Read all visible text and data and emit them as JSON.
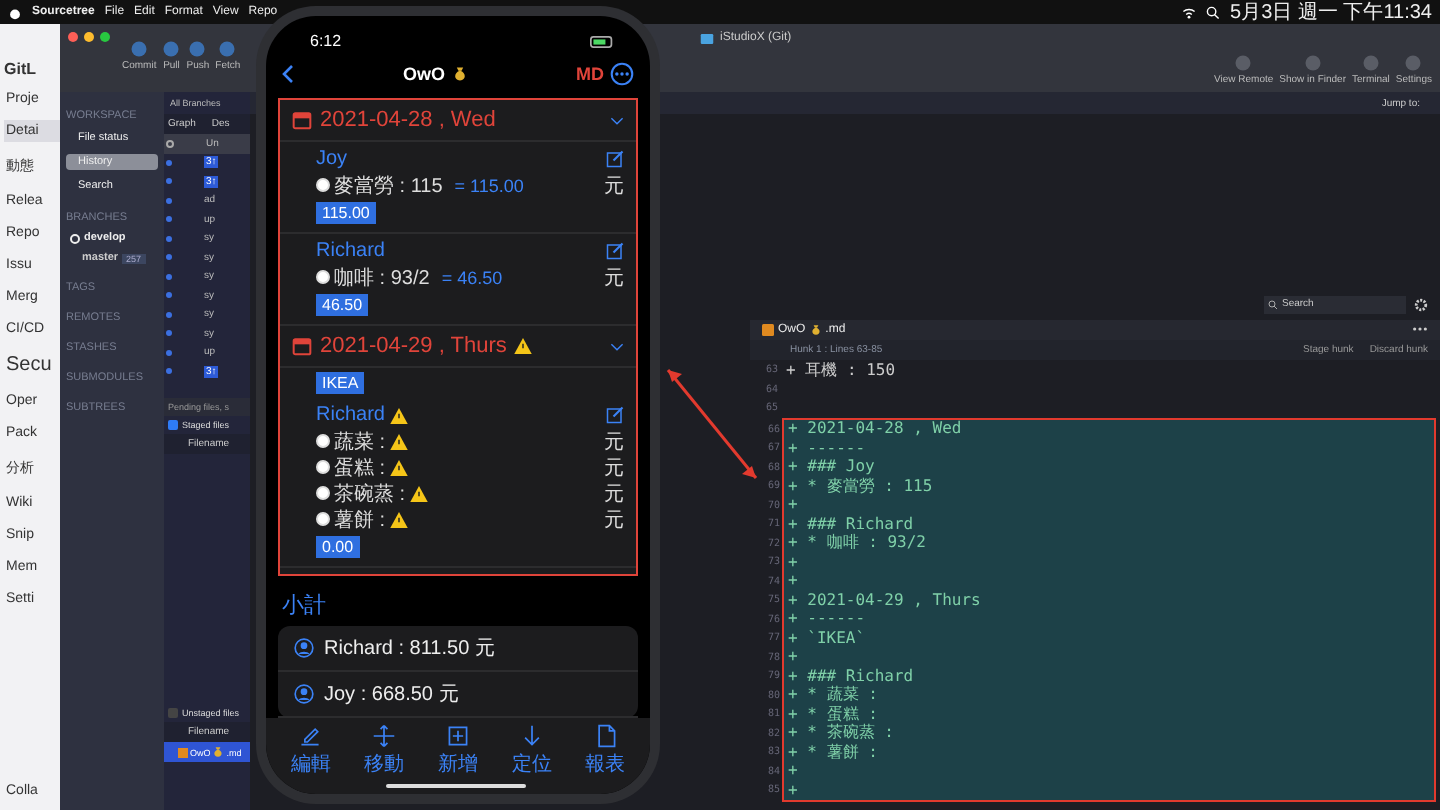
{
  "menu_bar": {
    "app": "Sourcetree",
    "menus": [
      "File",
      "Edit",
      "Format",
      "View",
      "Repo"
    ],
    "clock": "5月3日 週一 下午11:34"
  },
  "browser_sidebar": {
    "brand": "GitL",
    "items": [
      {
        "label": "Proje",
        "selected": false
      },
      {
        "label": "Detai",
        "selected": true
      },
      {
        "label": "動態",
        "selected": false
      },
      {
        "label": "Relea",
        "selected": false
      },
      {
        "label": "Repo",
        "selected": false
      },
      {
        "label": "Issu",
        "selected": false
      },
      {
        "label": "Merg",
        "selected": false
      },
      {
        "label": "CI/CD",
        "selected": false
      },
      {
        "label": "Secu",
        "selected": false
      },
      {
        "label": "Oper",
        "selected": false
      },
      {
        "label": "Pack",
        "selected": false
      },
      {
        "label": "分析",
        "selected": false
      },
      {
        "label": "Wiki",
        "selected": false
      },
      {
        "label": "Snip",
        "selected": false
      },
      {
        "label": "Mem",
        "selected": false
      },
      {
        "label": "Setti",
        "selected": false
      }
    ],
    "collapse": "Colla"
  },
  "window": {
    "title": "iStudioX (Git)",
    "toolbar_left": [
      "Commit",
      "Pull",
      "Push",
      "Fetch"
    ],
    "toolbar_right": [
      "View Remote",
      "Show in Finder",
      "Terminal",
      "Settings"
    ],
    "jump_label": "Jump to:"
  },
  "sidebar": [
    {
      "kind": "section",
      "label": "WORKSPACE"
    },
    {
      "kind": "item",
      "label": "File status",
      "selected": false
    },
    {
      "kind": "item",
      "label": "History",
      "selected": true
    },
    {
      "kind": "item",
      "label": "Search",
      "selected": false
    },
    {
      "kind": "section",
      "label": "BRANCHES"
    },
    {
      "kind": "branch",
      "label": "develop",
      "current": true
    },
    {
      "kind": "branch",
      "label": "master",
      "current": false,
      "badge": "257"
    },
    {
      "kind": "section",
      "label": "TAGS"
    },
    {
      "kind": "section",
      "label": "REMOTES"
    },
    {
      "kind": "section",
      "label": "STASHES"
    },
    {
      "kind": "section",
      "label": "SUBMODULES"
    },
    {
      "kind": "section",
      "label": "SUBTREES"
    }
  ],
  "commit_list": {
    "filter": "All Branches",
    "columns": [
      "Graph",
      "Des"
    ],
    "rows": [
      {
        "text": "Un",
        "kind": "uncommitted"
      },
      {
        "text": "3↑",
        "kind": "tag"
      },
      {
        "text": "3↑",
        "kind": "tag"
      },
      {
        "text": "ad",
        "kind": "plain"
      },
      {
        "text": "up",
        "kind": "plain"
      },
      {
        "text": "sy",
        "kind": "plain"
      },
      {
        "text": "sy",
        "kind": "plain"
      },
      {
        "text": "sy",
        "kind": "plain"
      },
      {
        "text": "sy",
        "kind": "plain"
      },
      {
        "text": "sy",
        "kind": "plain"
      },
      {
        "text": "sy",
        "kind": "plain"
      },
      {
        "text": "up",
        "kind": "plain"
      },
      {
        "text": "3↑",
        "kind": "tag"
      }
    ]
  },
  "pending": {
    "title": "Pending files, s",
    "staged": {
      "label": "Staged files",
      "checked": true
    },
    "staged_column": "Filename",
    "unstaged": {
      "label": "Unstaged files",
      "checked": false
    },
    "unstaged_column": "Filename",
    "files": [
      {
        "name": "OwO",
        "ext": ".md",
        "selected": true
      }
    ]
  },
  "diff": {
    "search": {
      "placeholder": "Search"
    },
    "file": {
      "name": "OwO",
      "ext": ".md"
    },
    "hunk": "Hunk 1 : Lines 63-85",
    "buttons": [
      "Stage hunk",
      "Discard hunk"
    ],
    "lines": [
      {
        "num": "63",
        "text": "+ 耳機 : 150",
        "added": false
      },
      {
        "num": "64",
        "added": false
      },
      {
        "num": "65",
        "added": false
      },
      {
        "num": "66",
        "text": "+ 2021-04-28 , Wed",
        "added": true
      },
      {
        "num": "67",
        "text": "+ ------",
        "added": true
      },
      {
        "num": "68",
        "text": "+ ### Joy",
        "added": true
      },
      {
        "num": "69",
        "text": "+ * 麥當勞 : 115",
        "added": true
      },
      {
        "num": "70",
        "text": "+",
        "added": true
      },
      {
        "num": "71",
        "text": "+ ### Richard",
        "added": true
      },
      {
        "num": "72",
        "text": "+ * 咖啡 : 93/2",
        "added": true
      },
      {
        "num": "73",
        "text": "+",
        "added": true
      },
      {
        "num": "74",
        "text": "+",
        "added": true
      },
      {
        "num": "75",
        "text": "+ 2021-04-29 , Thurs",
        "added": true
      },
      {
        "num": "76",
        "text": "+ ------",
        "added": true
      },
      {
        "num": "77",
        "text": "+ `IKEA`",
        "added": true
      },
      {
        "num": "78",
        "text": "+",
        "added": true
      },
      {
        "num": "79",
        "text": "+ ### Richard",
        "added": true
      },
      {
        "num": "80",
        "text": "+ * 蔬菜 :",
        "added": true
      },
      {
        "num": "81",
        "text": "+ * 蛋糕 :",
        "added": true
      },
      {
        "num": "82",
        "text": "+ * 茶碗蒸 :",
        "added": true
      },
      {
        "num": "83",
        "text": "+ * 薯餅 :",
        "added": true
      },
      {
        "num": "84",
        "text": "+",
        "added": true
      },
      {
        "num": "85",
        "text": "+",
        "added": true
      }
    ]
  },
  "phone": {
    "time": "6:12",
    "title": "OwO",
    "action": "MD",
    "days": [
      {
        "date": "2021-04-28 , Wed",
        "warning": false,
        "entries": [
          {
            "kind": "person",
            "name": "Joy",
            "warning": false,
            "items": [
              {
                "label": "麥當勞 : 115",
                "formula": "= 115.00",
                "unit": "元",
                "warning": false
              }
            ],
            "total": "115.00"
          },
          {
            "kind": "person",
            "name": "Richard",
            "warning": false,
            "items": [
              {
                "label": "咖啡 : 93/2",
                "formula": "= 46.50",
                "unit": "元",
                "warning": false
              }
            ],
            "total": "46.50"
          }
        ]
      },
      {
        "date": "2021-04-29 , Thurs",
        "warning": true,
        "entries": [
          {
            "kind": "tag",
            "name": "IKEA"
          },
          {
            "kind": "person",
            "name": "Richard",
            "warning": true,
            "items": [
              {
                "label": "蔬菜 :",
                "unit": "元",
                "warning": true
              },
              {
                "label": "蛋糕 :",
                "unit": "元",
                "warning": true
              },
              {
                "label": "茶碗蒸 :",
                "unit": "元",
                "warning": true
              },
              {
                "label": "薯餅 :",
                "unit": "元",
                "warning": true
              }
            ],
            "total": "0.00"
          }
        ]
      }
    ],
    "subtotal": {
      "title": "小計",
      "rows": [
        "Richard : 811.50 元",
        "Joy : 668.50 元"
      ]
    },
    "tabs": [
      {
        "kind": "edit",
        "label": "編輯"
      },
      {
        "kind": "move",
        "label": "移動"
      },
      {
        "kind": "add",
        "label": "新增"
      },
      {
        "kind": "locate",
        "label": "定位"
      },
      {
        "kind": "report",
        "label": "報表"
      }
    ]
  }
}
